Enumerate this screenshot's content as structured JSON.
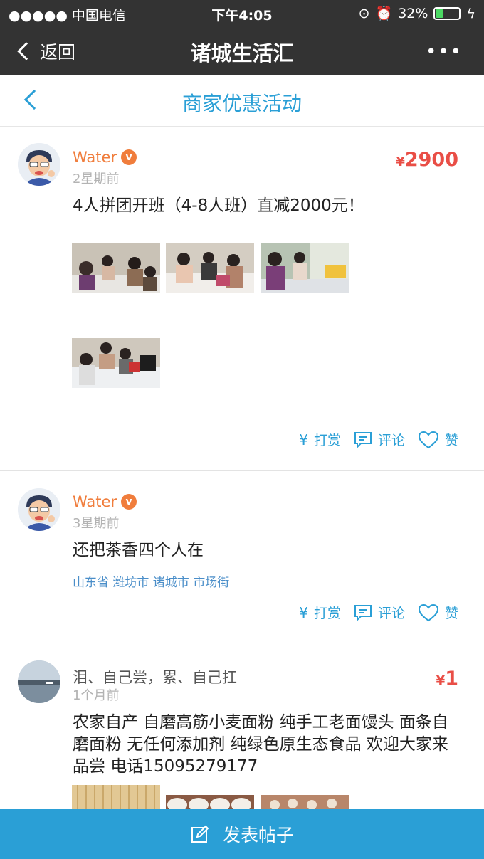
{
  "status_bar": {
    "carrier": "●●●●● 中国电信",
    "time": "下午4:05",
    "battery_pct": "32%",
    "battery_level": 0.32
  },
  "wechat_bar": {
    "back_label": "返回",
    "title": "诸城生活汇",
    "more": "•••"
  },
  "page": {
    "title": "商家优惠活动"
  },
  "posts": [
    {
      "user": "Water",
      "verified_badge": "v",
      "time": "2星期前",
      "price_symbol": "¥",
      "price": "2900",
      "content": "4人拼团开班（4-8人班）直减2000元！",
      "actions": {
        "tip": "打赏",
        "comment": "评论",
        "like": "赞"
      }
    },
    {
      "user": "Water",
      "verified_badge": "v",
      "time": "3星期前",
      "content": "还把茶香四个人在",
      "location": "山东省  潍坊市  诸城市  市场街",
      "actions": {
        "tip": "打赏",
        "comment": "评论",
        "like": "赞"
      }
    },
    {
      "user": "泪、自己尝，累、自己扛",
      "time": "1个月前",
      "price_symbol": "¥",
      "price": "1",
      "content": "农家自产 自磨高筋小麦面粉 纯手工老面馒头 面条自磨面粉 无任何添加剂 纯绿色原生态食品 欢迎大家来品尝 电话15095279177"
    }
  ],
  "bottom_bar": {
    "label": "发表帖子"
  },
  "colors": {
    "accent": "#2a9fd6",
    "username": "#f07d3c",
    "price": "#e94e46",
    "header_bg": "#333333"
  }
}
